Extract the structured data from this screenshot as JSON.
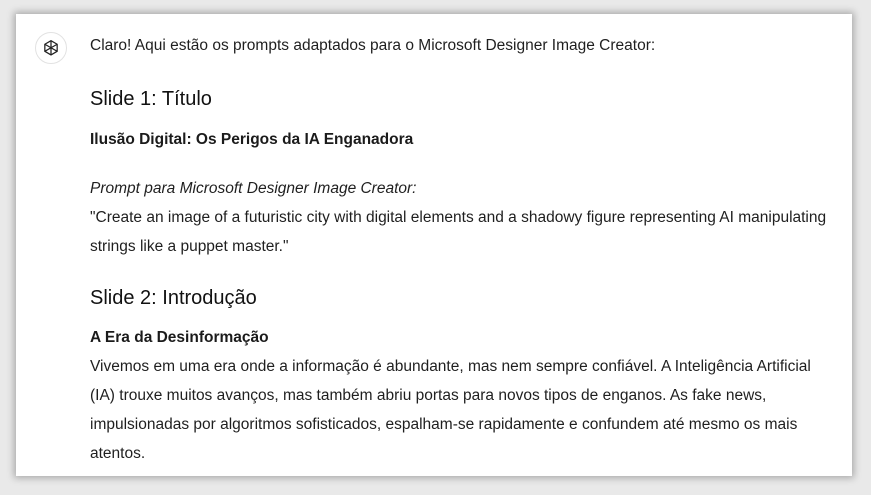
{
  "assistant": {
    "avatar_icon": "openai-logo-icon",
    "intro": "Claro! Aqui estão os prompts adaptados para o Microsoft Designer Image Creator:"
  },
  "slides": [
    {
      "heading": "Slide 1: Título",
      "subtitle": "Ilusão Digital: Os Perigos da IA Enganadora",
      "prompt_label": "Prompt para Microsoft Designer Image Creator:",
      "prompt_text": "\"Create an image of a futuristic city with digital elements and a shadowy figure representing AI manipulating strings like a puppet master.\""
    },
    {
      "heading": "Slide 2: Introdução",
      "subtitle": "A Era da Desinformação",
      "body": "Vivemos em uma era onde a informação é abundante, mas nem sempre confiável. A Inteligência Artificial (IA) trouxe muitos avanços, mas também abriu portas para novos tipos de enganos. As fake news, impulsionadas por algoritmos sofisticados, espalham-se rapidamente e confundem até mesmo os mais atentos."
    }
  ]
}
